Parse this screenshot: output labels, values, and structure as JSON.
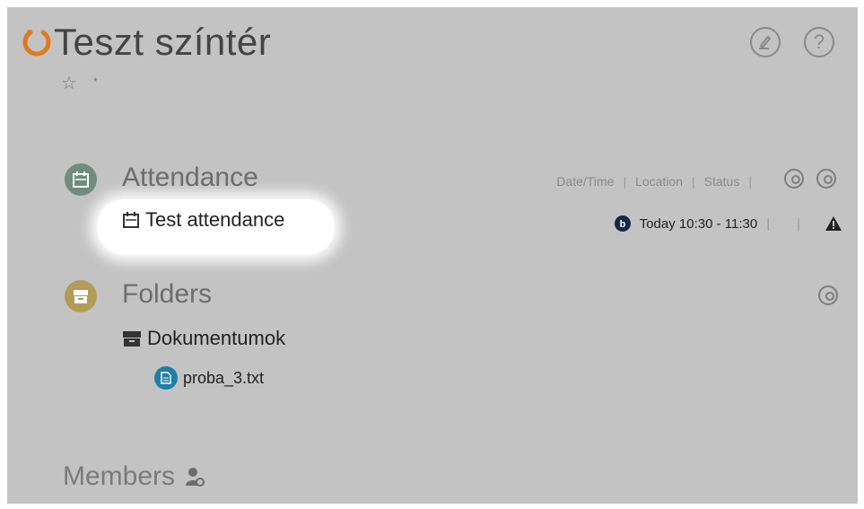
{
  "page": {
    "title": "Teszt színtér",
    "star_icon": "star-icon",
    "asterisk": "*"
  },
  "header": {
    "edit_icon": "edit-icon",
    "help_icon": "help-icon",
    "help_label": "?"
  },
  "attendance": {
    "title": "Attendance",
    "columns": {
      "date_time": "Date/Time",
      "location": "Location",
      "status": "Status"
    },
    "items": [
      {
        "name": "Test attendance",
        "time": "Today 10:30 - 11:30",
        "status_icon": "warning-icon"
      }
    ],
    "accent": "#6f8c7f"
  },
  "folders": {
    "title": "Folders",
    "accent": "#b29c58",
    "items": [
      {
        "name": "Dokumentumok",
        "children": [
          {
            "name": "proba_3.txt"
          }
        ]
      }
    ]
  },
  "members": {
    "title": "Members"
  },
  "colors": {
    "logo": "#e07a1a",
    "file_icon": "#1e7fa8",
    "bbb_icon": "#1a2744"
  }
}
